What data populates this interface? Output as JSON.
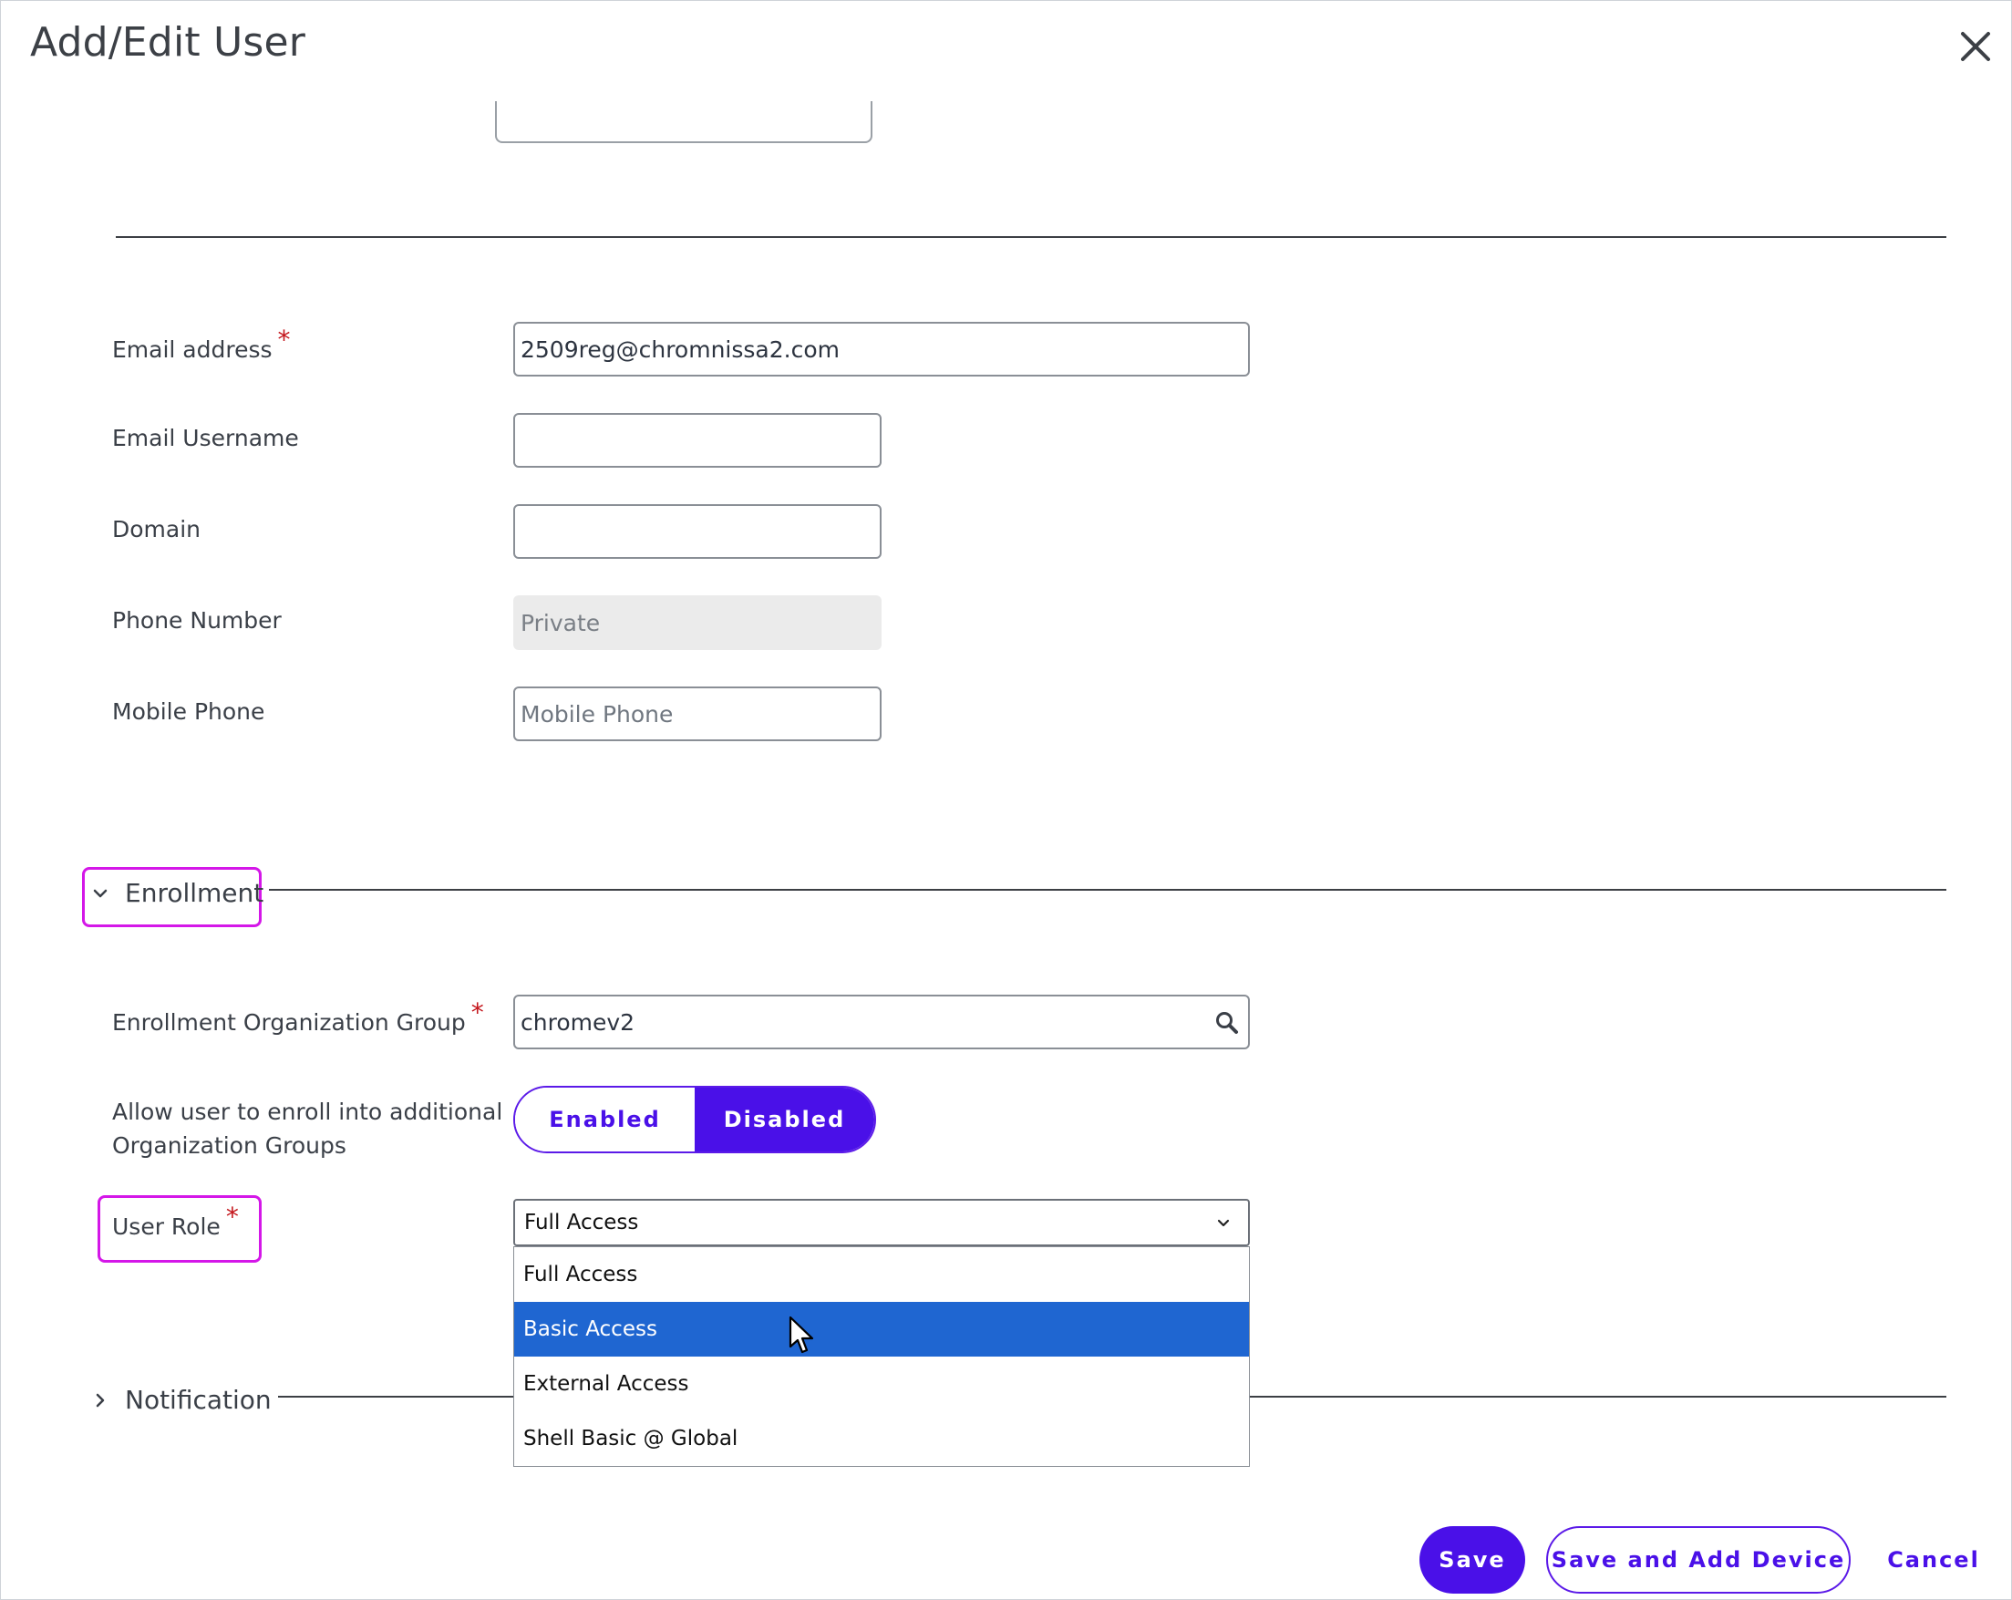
{
  "dialog": {
    "title": "Add/Edit User"
  },
  "fields": {
    "email_address": {
      "label": "Email address",
      "required": "*",
      "value": "2509reg@chromnissa2.com"
    },
    "email_username": {
      "label": "Email Username",
      "value": ""
    },
    "domain": {
      "label": "Domain",
      "value": ""
    },
    "phone_number": {
      "label": "Phone Number",
      "value": "Private"
    },
    "mobile_phone": {
      "label": "Mobile Phone",
      "placeholder": "Mobile Phone"
    }
  },
  "enrollment": {
    "section_label": "Enrollment",
    "org_group": {
      "label": "Enrollment Organization Group",
      "required": "*",
      "value": "chromev2"
    },
    "additional_groups": {
      "label_line1": "Allow user to enroll into additional",
      "label_line2": "Organization Groups",
      "enabled_label": "Enabled",
      "disabled_label": "Disabled",
      "selected": "Disabled"
    },
    "user_role": {
      "label": "User Role",
      "required": "*",
      "selected": "Full Access",
      "options": [
        "Full Access",
        "Basic Access",
        "External Access",
        "Shell Basic @ Global"
      ],
      "highlighted": "Basic Access"
    }
  },
  "notification": {
    "section_label": "Notification"
  },
  "footer": {
    "save_label": "Save",
    "save_add_label": "Save and Add Device",
    "cancel_label": "Cancel"
  },
  "colors": {
    "accent": "#4a10e8",
    "focus_outline": "#d417e8",
    "dropdown_highlight": "#1f66d1",
    "required": "#c4161c"
  }
}
